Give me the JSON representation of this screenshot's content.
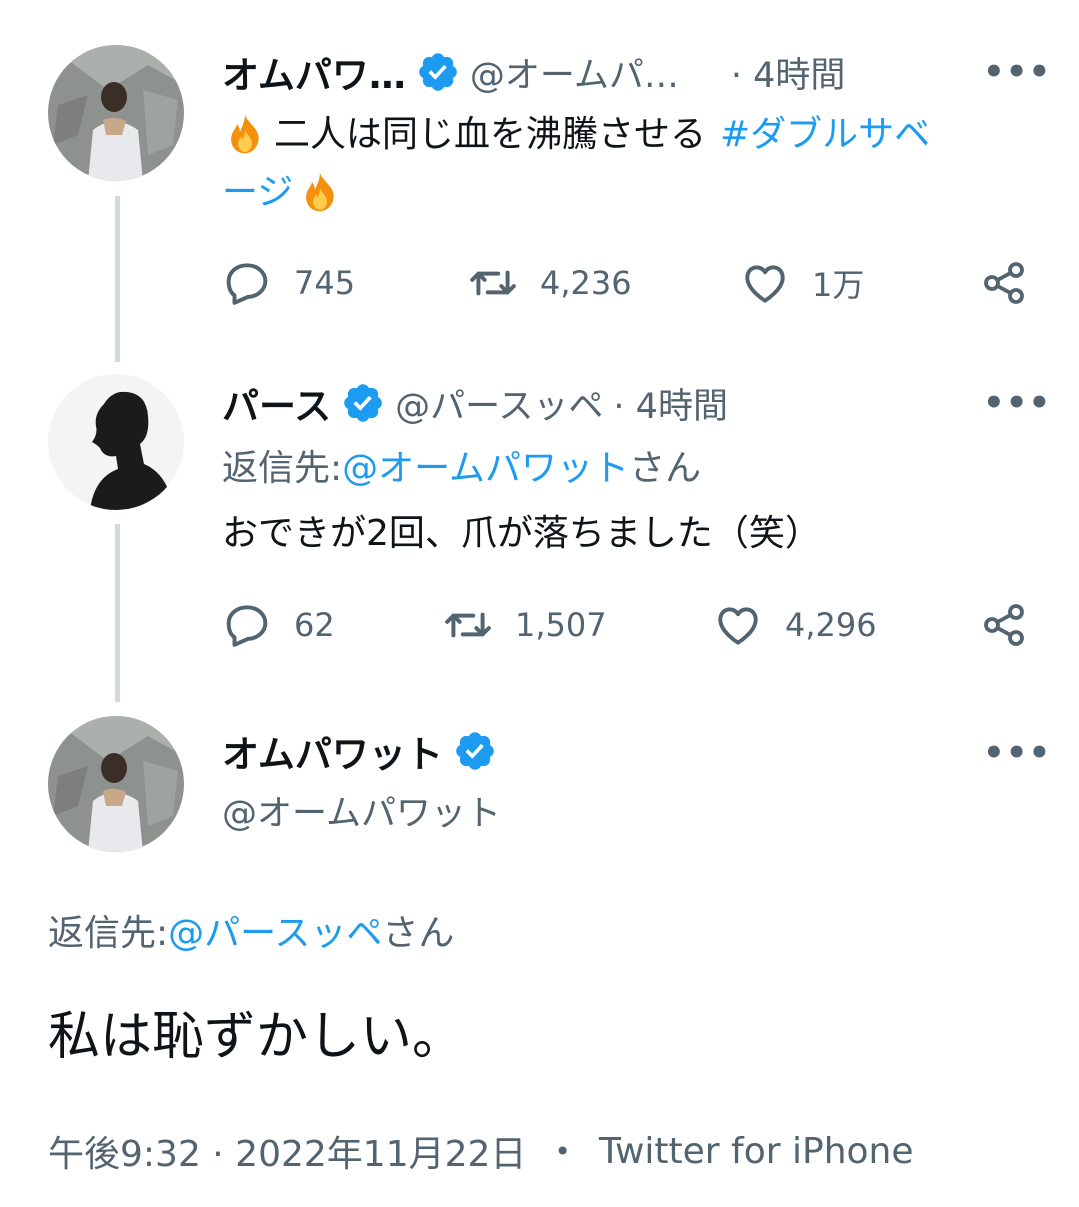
{
  "tweets": [
    {
      "name": "オムパワ…",
      "handle": "@オームパ…",
      "time": "· 4時間",
      "text_line1": "二人は同じ血を沸騰させる",
      "hashtag_line1": "#ダブルサベ",
      "hashtag_line2": "ージ",
      "emoji": "🔥",
      "replies": "745",
      "retweets": "4,236",
      "likes": "1万"
    },
    {
      "name": "パース",
      "handle": "@パースッペ",
      "time": "· 4時間",
      "reply_prefix": "返信先:",
      "reply_mention": "@オームパワット",
      "reply_suffix": "さん",
      "text": "おできが2回、爪が落ちました（笑）",
      "replies": "62",
      "retweets": "1,507",
      "likes": "4,296"
    }
  ],
  "main_tweet": {
    "name": "オムパワット",
    "handle": "@オームパワット",
    "reply_prefix": "返信先:",
    "reply_mention": "@パースッペ",
    "reply_suffix": "さん",
    "text": "私は恥ずかしい。",
    "timestamp": "午後9:32 · 2022年11月22日",
    "separator": "•",
    "source": "Twitter for iPhone"
  },
  "more_label": "•••",
  "colors": {
    "link": "#1d9bf0",
    "verified": "#1d9bf0",
    "muted": "#536471",
    "thread_line": "#cfd9de"
  },
  "icons": [
    "reply-icon",
    "retweet-icon",
    "like-icon",
    "share-icon",
    "verified-badge-icon",
    "fire-emoji"
  ]
}
